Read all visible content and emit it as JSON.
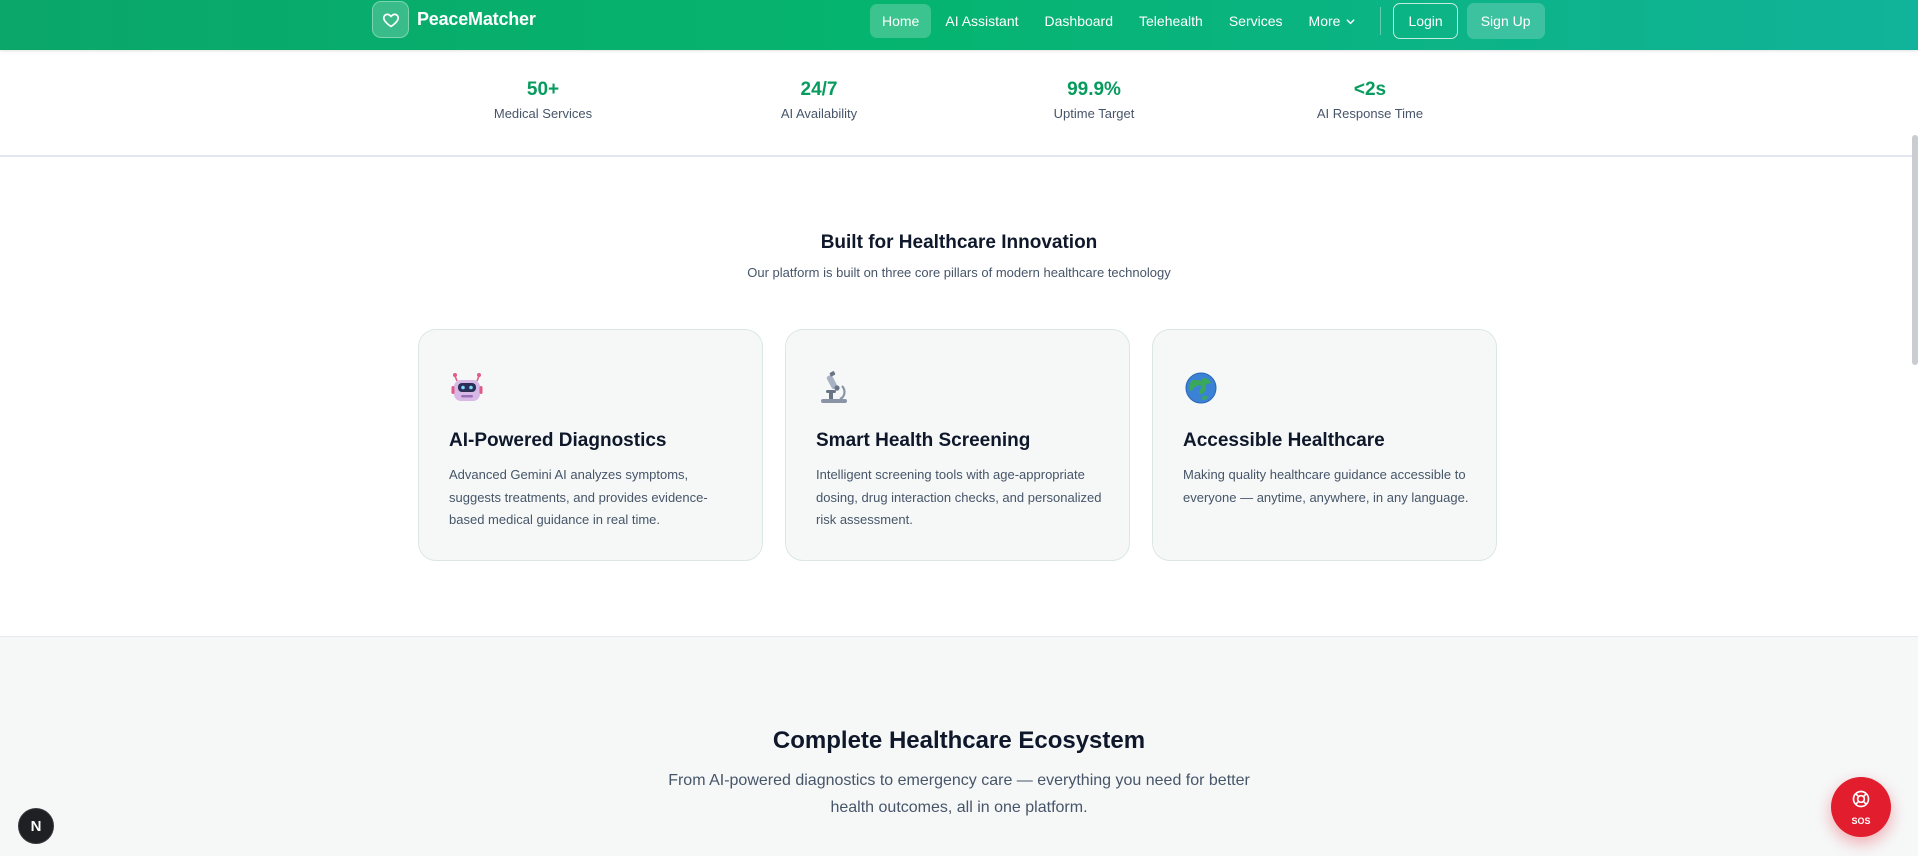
{
  "header": {
    "brand": "PeaceMatcher",
    "nav": [
      {
        "label": "Home",
        "active": true
      },
      {
        "label": "AI Assistant"
      },
      {
        "label": "Dashboard"
      },
      {
        "label": "Telehealth"
      },
      {
        "label": "Services"
      },
      {
        "label": "More",
        "has_dropdown": true
      }
    ],
    "login_label": "Login",
    "signup_label": "Sign Up"
  },
  "stats": [
    {
      "value": "50+",
      "label": "Medical Services"
    },
    {
      "value": "24/7",
      "label": "AI Availability"
    },
    {
      "value": "99.9%",
      "label": "Uptime Target"
    },
    {
      "value": "<2s",
      "label": "AI Response Time"
    }
  ],
  "pillars": {
    "title": "Built for Healthcare Innovation",
    "subtitle": "Our platform is built on three core pillars of modern healthcare technology",
    "cards": [
      {
        "icon": "robot-icon",
        "title": "AI-Powered Diagnostics",
        "description": "Advanced Gemini AI analyzes symptoms, suggests treatments, and provides evidence-based medical guidance in real time."
      },
      {
        "icon": "microscope-icon",
        "title": "Smart Health Screening",
        "description": "Intelligent screening tools with age-appropriate dosing, drug interaction checks, and personalized risk assessment."
      },
      {
        "icon": "globe-icon",
        "title": "Accessible Healthcare",
        "description": "Making quality healthcare guidance accessible to everyone — anytime, anywhere, in any language."
      }
    ]
  },
  "ecosystem": {
    "title": "Complete Healthcare Ecosystem",
    "subtitle": "From AI-powered diagnostics to emergency care — everything you need for better health outcomes, all in one platform."
  },
  "floating": {
    "dev_badge": "N",
    "sos_label": "SOS"
  },
  "colors": {
    "brand_green": "#05b46e",
    "stat_green": "#079b5e",
    "sos_red": "#e11d2e"
  }
}
